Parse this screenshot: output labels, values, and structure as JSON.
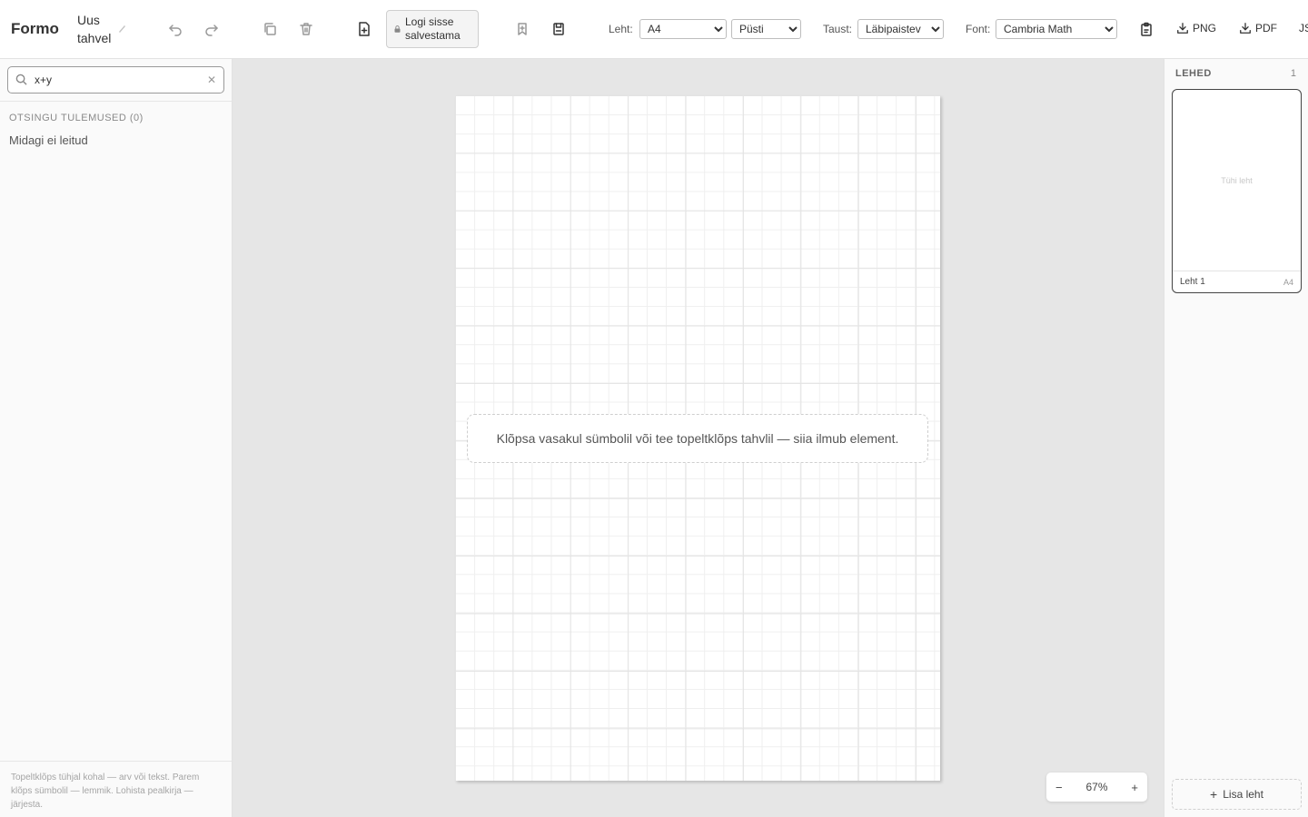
{
  "toolbar": {
    "app_name": "Formo",
    "board_title": "Uus tahvel",
    "login_label": "Logi sisse salvestama",
    "sheet_label": "Leht:",
    "sheet_size": "A4",
    "orientation": "Püsti",
    "background_label": "Taust:",
    "background": "Läbipaistev",
    "font_label": "Font:",
    "font": "Cambria Math",
    "png_label": "PNG",
    "pdf_label": "PDF",
    "cut_off_label": "JS",
    "icons": [
      "pencil-icon",
      "undo-icon",
      "redo-icon",
      "copy-icon",
      "trash-icon",
      "new-file-icon",
      "lock-icon",
      "bookmark-icon",
      "save-icon",
      "clipboard-icon",
      "download-icon"
    ]
  },
  "sidebar": {
    "search_value": "x+y",
    "results_heading": "OTSINGU TULEMUSED (0)",
    "no_results": "Midagi ei leitud",
    "footer_hint": "Topeltklõps tühjal kohal — arv või tekst. Parem klõps sümbolil — lemmik. Lohista pealkirja — järjesta."
  },
  "canvas": {
    "hint": "Klõpsa vasakul sümbolil või tee topeltklõps tahvlil — siia ilmub element.",
    "zoom_out": "−",
    "zoom_level": "67%",
    "zoom_in": "+"
  },
  "pages": {
    "heading": "LEHED",
    "count": "1",
    "items": [
      {
        "empty_label": "Tühi leht",
        "name": "Leht 1",
        "size": "A4"
      }
    ],
    "add_label": "Lisa leht"
  }
}
